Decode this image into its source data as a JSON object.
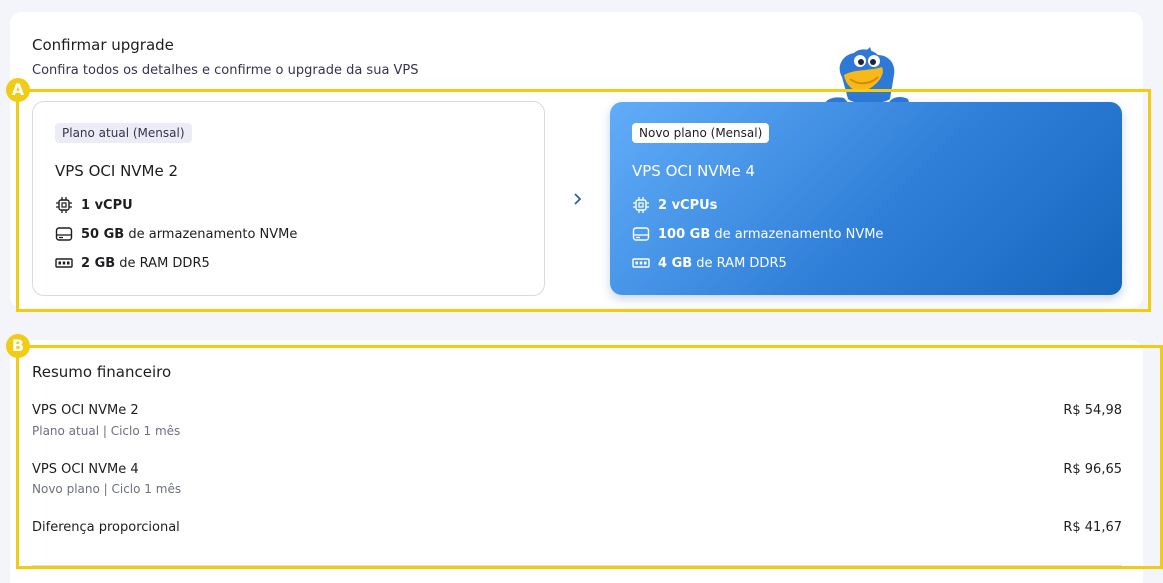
{
  "header": {
    "title": "Confirmar upgrade",
    "subtitle": "Confira todos os detalhes e confirme o upgrade da sua VPS"
  },
  "current_plan": {
    "badge": "Plano atual (Mensal)",
    "name": "VPS OCI NVMe 2",
    "specs": [
      {
        "icon": "cpu-icon",
        "bold": "1 vCPU",
        "text": ""
      },
      {
        "icon": "storage-icon",
        "bold": "50 GB",
        "text": "de armazenamento NVMe"
      },
      {
        "icon": "ram-icon",
        "bold": "2 GB",
        "text": "de RAM DDR5"
      }
    ]
  },
  "new_plan": {
    "badge": "Novo plano (Mensal)",
    "name": "VPS OCI NVMe 4",
    "specs": [
      {
        "icon": "cpu-icon",
        "bold": "2 vCPUs",
        "text": ""
      },
      {
        "icon": "storage-icon",
        "bold": "100 GB",
        "text": "de armazenamento NVMe"
      },
      {
        "icon": "ram-icon",
        "bold": "4 GB",
        "text": "de RAM DDR5"
      }
    ]
  },
  "annotations": {
    "a": "A",
    "b": "B",
    "color": "#f1cc16"
  },
  "summary": {
    "title": "Resumo financeiro",
    "rows": [
      {
        "name": "VPS OCI NVMe 2",
        "sub": "Plano atual | Ciclo 1 mês",
        "price": "R$ 54,98"
      },
      {
        "name": "VPS OCI NVMe 4",
        "sub": "Novo plano | Ciclo 1 mês",
        "price": "R$ 96,65"
      },
      {
        "name": "Diferença proporcional",
        "sub": "",
        "price": "R$ 41,67"
      }
    ]
  },
  "colors": {
    "new_plan_gradient_start": "#62adf9",
    "new_plan_gradient_end": "#1665bd",
    "text_dark": "#1d1e20",
    "accent_arrow": "#2f5fa8"
  }
}
